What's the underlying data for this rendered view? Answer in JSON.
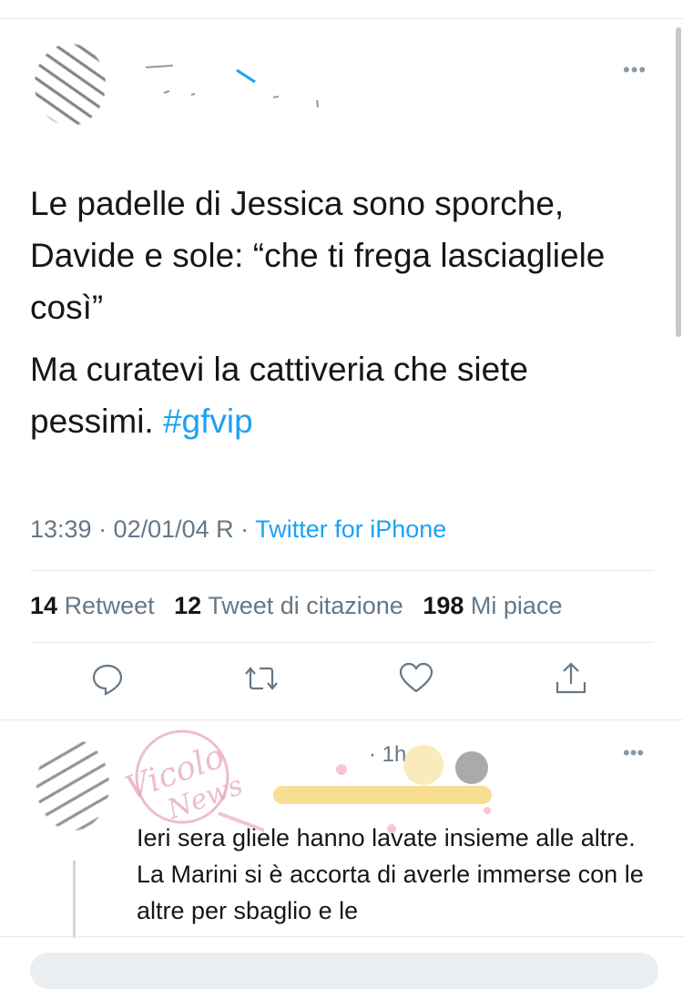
{
  "tweet": {
    "text_lines": [
      "Le padelle di Jessica sono sporche, Davide e sole: “che ti frega lasciagliele così”",
      "Ma curatevi la cattiveria che siete pessimi."
    ],
    "hashtag": "#gfvip",
    "time": "13:39 · 02/01/04 R",
    "separator": " · ",
    "source": "Twitter for iPhone"
  },
  "stats": {
    "retweets_count": "14",
    "retweets_label": "Retweet",
    "quotes_count": "12",
    "quotes_label": "Tweet di citazione",
    "likes_count": "198",
    "likes_label": "Mi piace"
  },
  "reply": {
    "time": "· 1h",
    "text": "Ieri sera gliele hanno lavate insieme alle altre. La Marini si è accorta di averle immerse con le altre per sbaglio e le"
  },
  "icons": {
    "more": "more-icon",
    "reply": "reply-icon",
    "retweet": "retweet-icon",
    "like": "heart-icon",
    "share": "share-icon"
  },
  "colors": {
    "accent": "#1da1f2",
    "secondary_text": "#657786",
    "primary_text": "#14171a",
    "divider": "#e1e8ed"
  }
}
